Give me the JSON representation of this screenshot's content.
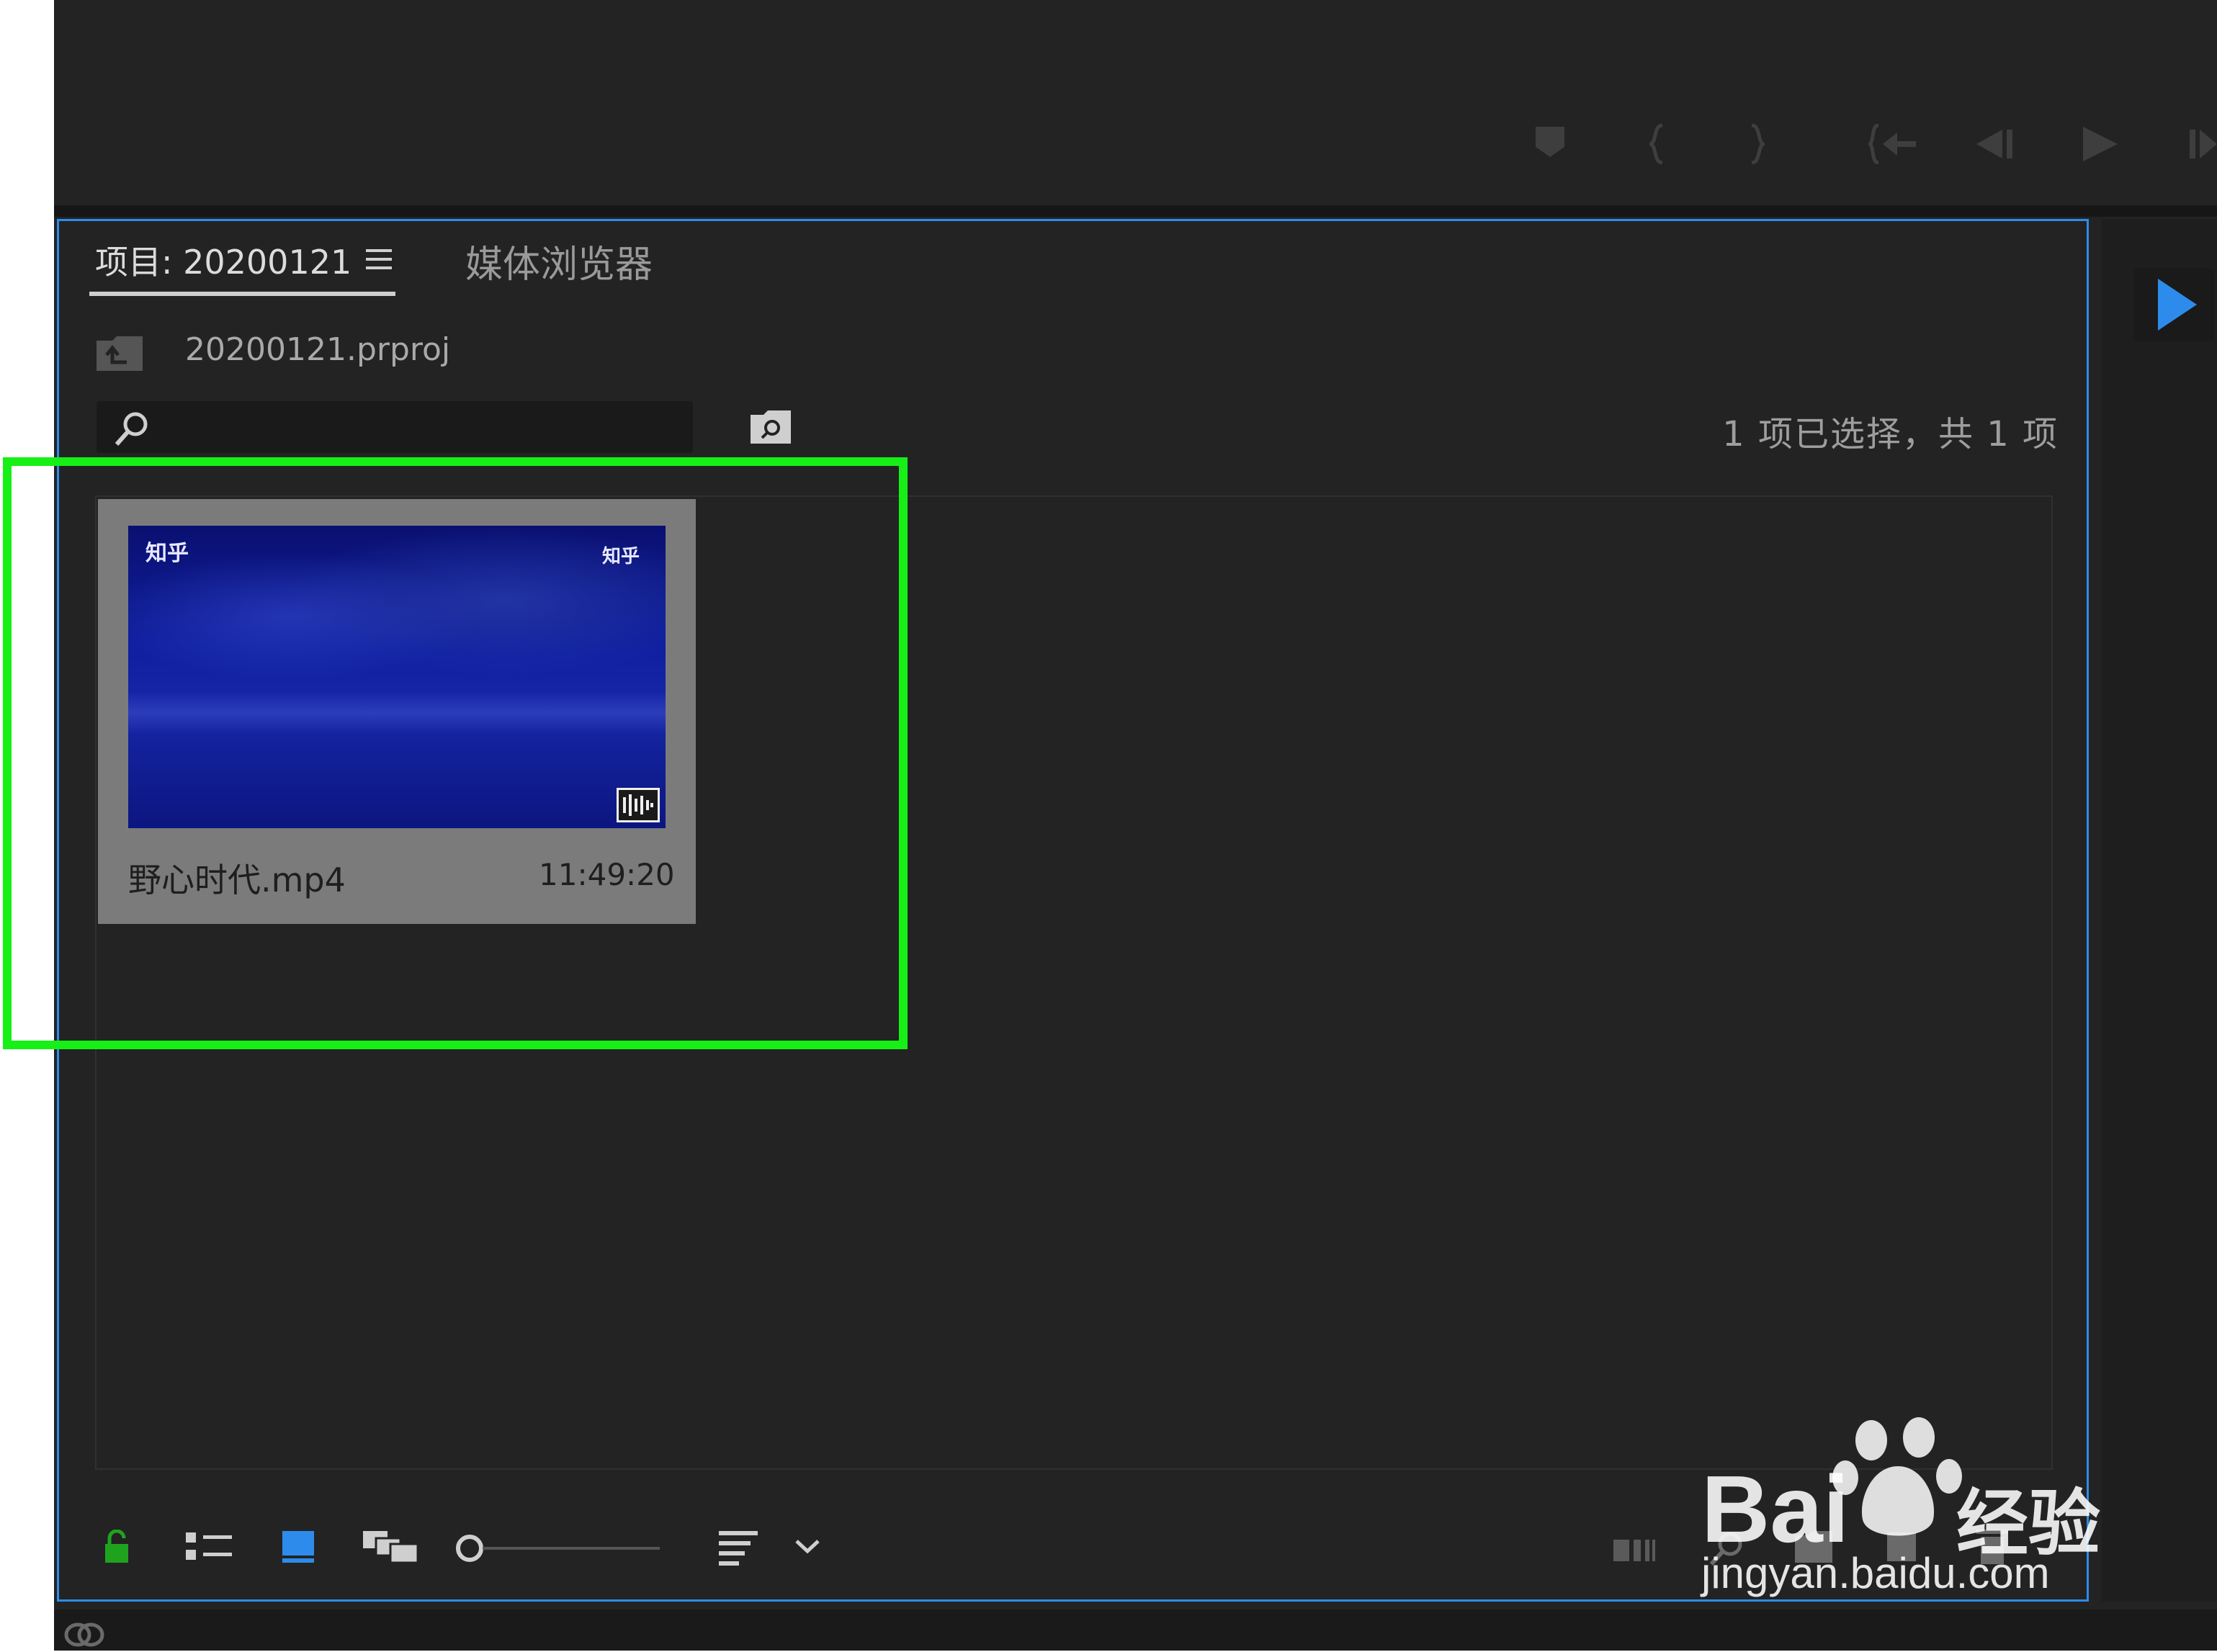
{
  "project_tab": {
    "label": "项目: 20200121"
  },
  "media_browser_tab": {
    "label": "媒体浏览器"
  },
  "project_file": "20200121.prproj",
  "search": {
    "value": "",
    "placeholder": ""
  },
  "selection_status": "1 项已选择，共 1 项",
  "clip": {
    "name": "野心时代.mp4",
    "duration": "11:49:20",
    "thumb_logo_left": "知乎",
    "thumb_logo_right": "知乎"
  },
  "watermark": {
    "brand": "Bai",
    "brand_suffix": "经验",
    "url": "jingyan.baidu.com"
  },
  "colors": {
    "panel_border": "#2d8ceb",
    "highlight": "#16f016",
    "lock_icon": "#1fa31f",
    "icon_view_active": "#2d8ceb"
  }
}
